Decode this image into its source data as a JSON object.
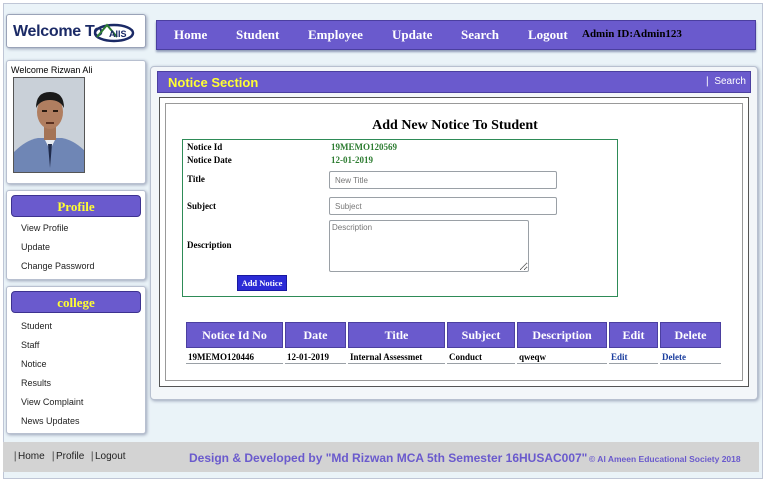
{
  "header": {
    "logo_text": "Welcome To",
    "logo_mark": "AIIS",
    "nav": [
      "Home",
      "Student",
      "Employee",
      "Update",
      "Search",
      "Logout"
    ],
    "admin_id": "Admin ID:Admin123"
  },
  "sidebar": {
    "welcome": "Welcome Rizwan Ali",
    "profile_heading": "Profile",
    "profile_links": [
      "View Profile",
      "Update",
      "Change Password"
    ],
    "college_heading": "college",
    "college_links": [
      "Student",
      "Staff",
      "Notice",
      "Results",
      "View Complaint",
      "News Updates"
    ]
  },
  "main": {
    "section_title": "Notice Section",
    "search_link": "Search",
    "form": {
      "title": "Add New Notice To Student",
      "notice_id_label": "Notice Id",
      "notice_id_value": "19MEMO120569",
      "notice_date_label": "Notice Date",
      "notice_date_value": "12-01-2019",
      "title_label": "Title",
      "title_placeholder": "New Title",
      "subject_label": "Subject",
      "subject_placeholder": "Subject",
      "description_label": "Description",
      "description_placeholder": "Description",
      "submit_label": "Add Notice"
    },
    "table": {
      "columns": [
        "Notice Id No",
        "Date",
        "Title",
        "Subject",
        "Description",
        "Edit",
        "Delete"
      ],
      "rows": [
        {
          "id": "19MEMO120446",
          "date": "12-01-2019",
          "title": "Internal Assessmet",
          "subject": "Conduct",
          "description": "qweqw",
          "edit": "Edit",
          "delete": "Delete"
        }
      ]
    }
  },
  "footer": {
    "links": [
      "Home",
      "Profile",
      "Logout"
    ],
    "credit": "Design & Developed by \"Md Rizwan MCA 5th Semester 16HUSAC007\"",
    "copyright": "© Al Ameen Educational Society 2018"
  },
  "colors": {
    "accent": "#6a5acd",
    "heading_yellow": "#ffff33",
    "value_green": "#2e7d32",
    "button_blue": "#2b2bd6"
  }
}
